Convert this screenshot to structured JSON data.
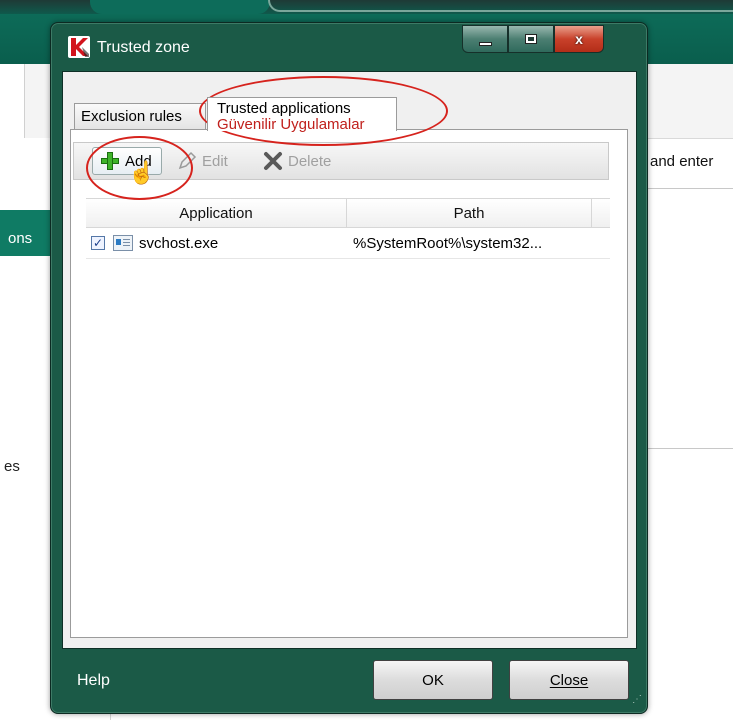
{
  "background": {
    "sidebar_active_label": "ons",
    "sidebar_lower_label": "es",
    "right_text": "and enter"
  },
  "window": {
    "title": "Trusted zone",
    "controls": {
      "minimize": "minimize-icon",
      "maximize": "maximize-icon",
      "close": "close-icon",
      "close_glyph": "x"
    }
  },
  "tabs": [
    {
      "label": "Exclusion rules"
    },
    {
      "label": "Trusted applications",
      "annotation": "Güvenilir Uygulamalar"
    }
  ],
  "toolbar": {
    "add_label": "Add",
    "edit_label": "Edit",
    "delete_label": "Delete",
    "cursor_glyph": "☝"
  },
  "table": {
    "columns": [
      "Application",
      "Path"
    ],
    "rows": [
      {
        "checked": true,
        "check_glyph": "✓",
        "application": "svchost.exe",
        "path": "%SystemRoot%\\system32..."
      }
    ]
  },
  "footer": {
    "help_label": "Help",
    "ok_label": "OK",
    "close_label": "Close"
  },
  "colors": {
    "window_frame": "#1b5a47",
    "annotation_red": "#d6231d",
    "add_green": "#3fb42a"
  }
}
